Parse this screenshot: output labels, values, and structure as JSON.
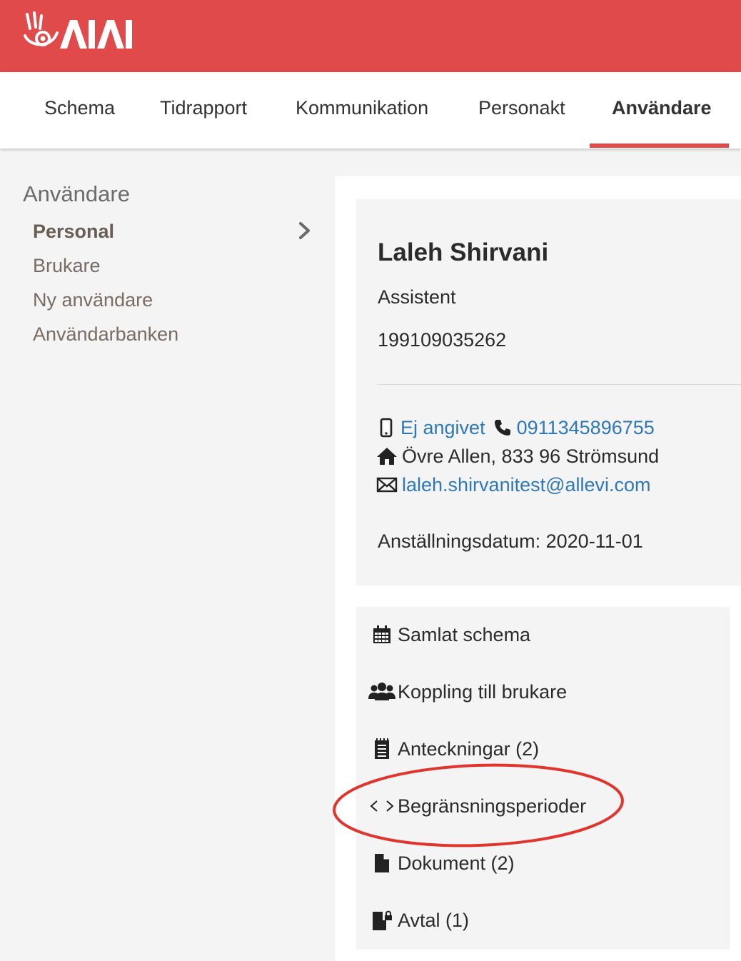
{
  "brand": {
    "logo_text": "AIAI",
    "color": "#e04a4b"
  },
  "nav": {
    "items": [
      {
        "label": "Schema"
      },
      {
        "label": "Tidrapport"
      },
      {
        "label": "Kommunikation"
      },
      {
        "label": "Personakt"
      },
      {
        "label": "Användare",
        "active": true
      }
    ]
  },
  "sidebar": {
    "title": "Användare",
    "items": [
      {
        "label": "Personal",
        "active": true
      },
      {
        "label": "Brukare"
      },
      {
        "label": "Ny användare"
      },
      {
        "label": "Användarbanken"
      }
    ]
  },
  "profile": {
    "name": "Laleh Shirvani",
    "role": "Assistent",
    "personal_number": "199109035262",
    "mobile": "Ej angivet",
    "phone": "0911345896755",
    "address": "Övre Allen, 833 96 Strömsund",
    "email": "laleh.shirvanitest@allevi.com",
    "employment_date": "Anställningsdatum: 2020-11-01"
  },
  "menu": {
    "items": [
      {
        "label": "Samlat schema",
        "icon": "calendar-icon"
      },
      {
        "label": "Koppling till brukare",
        "icon": "users-icon"
      },
      {
        "label": "Anteckningar (2)",
        "icon": "notes-icon"
      },
      {
        "label": "Begränsningsperioder",
        "icon": "code-brackets-icon",
        "highlighted": true
      },
      {
        "label": "Dokument (2)",
        "icon": "document-icon"
      },
      {
        "label": "Avtal (1)",
        "icon": "contract-lock-icon"
      }
    ]
  },
  "colors": {
    "link": "#2f78b7",
    "highlight_ring": "#e0342c"
  }
}
